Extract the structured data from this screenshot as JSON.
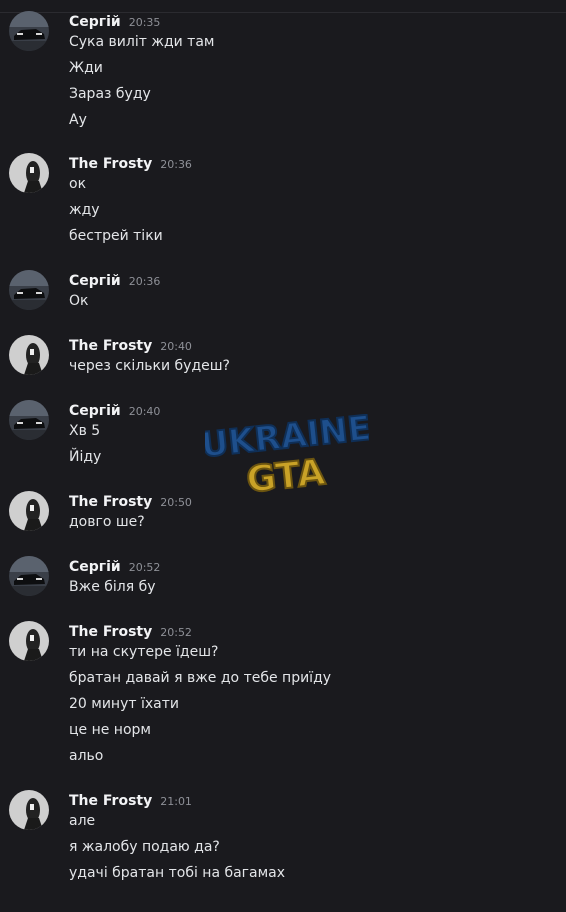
{
  "groups": [
    {
      "author": "Сергій",
      "time": "20:35",
      "avatar": "car-avatar",
      "messages": [
        "Сука виліт жди там",
        "Жди",
        "Зараз буду",
        "Ау"
      ]
    },
    {
      "author": "The Frosty",
      "time": "20:36",
      "avatar": "hooded-figure-avatar",
      "messages": [
        "ок",
        "жду",
        "бестрей тіки"
      ]
    },
    {
      "author": "Сергій",
      "time": "20:36",
      "avatar": "car-avatar",
      "messages": [
        "Ок"
      ]
    },
    {
      "author": "The Frosty",
      "time": "20:40",
      "avatar": "hooded-figure-avatar",
      "messages": [
        "через скільки будеш?"
      ]
    },
    {
      "author": "Сергій",
      "time": "20:40",
      "avatar": "car-avatar",
      "messages": [
        "Хв 5",
        "Йіду"
      ]
    },
    {
      "author": "The Frosty",
      "time": "20:50",
      "avatar": "hooded-figure-avatar",
      "messages": [
        "довго ше?"
      ]
    },
    {
      "author": "Сергій",
      "time": "20:52",
      "avatar": "car-avatar",
      "messages": [
        "Вже біля бу"
      ]
    },
    {
      "author": "The Frosty",
      "time": "20:52",
      "avatar": "hooded-figure-avatar",
      "messages": [
        "ти на скутере їдеш?",
        "братан давай я вже до тебе приїду",
        "20 минут їхати",
        "це не норм",
        "альо"
      ]
    },
    {
      "author": "The Frosty",
      "time": "21:01",
      "avatar": "hooded-figure-avatar",
      "messages": [
        "але",
        "я жалобу подаю да?",
        "удачі братан тобі на багамах"
      ]
    }
  ],
  "watermark": {
    "line1": "UKRAINE",
    "line2": "GTA",
    "color1": "#1e4f8c",
    "color2": "#c9a227"
  },
  "colors": {
    "background": "#1a1a1e",
    "username": "#f2f3f5",
    "timestamp": "#8e9097",
    "message": "#e3e5e8"
  }
}
